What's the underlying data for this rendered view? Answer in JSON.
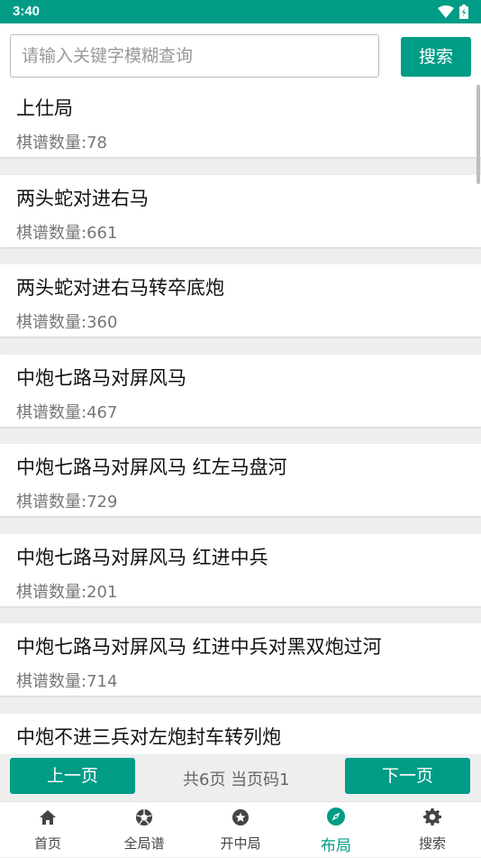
{
  "status_bar": {
    "time": "3:40",
    "icons": [
      "wifi-icon",
      "battery-icon"
    ]
  },
  "search": {
    "placeholder": "请输入关键字模糊查询",
    "button_label": "搜索"
  },
  "list": {
    "items": [
      {
        "name": "上仕局",
        "count": "棋谱数量:78"
      },
      {
        "name": "两头蛇对进右马",
        "count": "棋谱数量:661"
      },
      {
        "name": "两头蛇对进右马转卒底炮",
        "count": "棋谱数量:360"
      },
      {
        "name": "中炮七路马对屏风马",
        "count": "棋谱数量:467"
      },
      {
        "name": "中炮七路马对屏风马 红左马盘河",
        "count": "棋谱数量:729"
      },
      {
        "name": "中炮七路马对屏风马 红进中兵",
        "count": "棋谱数量:201"
      },
      {
        "name": "中炮七路马对屏风马 红进中兵对黑双炮过河",
        "count": "棋谱数量:714"
      },
      {
        "name": "中炮不进三兵对左炮封车转列炮",
        "count": ""
      }
    ]
  },
  "pager": {
    "prev_label": "上一页",
    "next_label": "下一页",
    "info": "共6页  当页码1"
  },
  "bottom_nav": {
    "items": [
      {
        "label": "首页",
        "icon": "home-icon"
      },
      {
        "label": "全局谱",
        "icon": "aperture-icon"
      },
      {
        "label": "开中局",
        "icon": "star-circle-icon"
      },
      {
        "label": "布局",
        "icon": "compass-icon",
        "active": true
      },
      {
        "label": "搜索",
        "icon": "gear-icon"
      }
    ]
  },
  "colors": {
    "accent": "#009c86",
    "background": "#eeeeee",
    "card": "#ffffff"
  }
}
